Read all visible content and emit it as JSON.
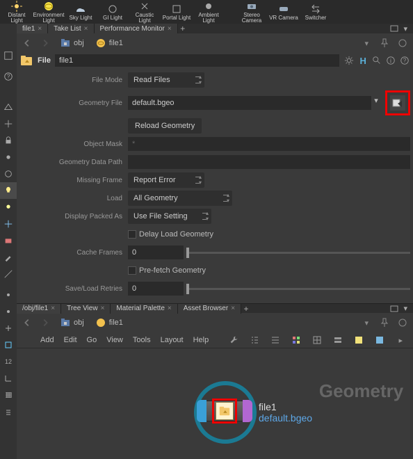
{
  "shelf": [
    {
      "label": "Distant Light"
    },
    {
      "label": "Environment Light"
    },
    {
      "label": "Sky Light"
    },
    {
      "label": "GI Light"
    },
    {
      "label": "Caustic Light"
    },
    {
      "label": "Portal Light"
    },
    {
      "label": "Ambient Light"
    },
    {
      "label": "Stereo Camera"
    },
    {
      "label": "VR Camera"
    },
    {
      "label": "Switcher"
    }
  ],
  "upper": {
    "tabs": [
      {
        "label": "file1"
      },
      {
        "label": "Take List"
      },
      {
        "label": "Performance Monitor"
      }
    ],
    "path": {
      "ctx": "obj",
      "node": "file1"
    },
    "header": {
      "kind": "File",
      "name": "file1"
    },
    "params": {
      "file_mode_label": "File Mode",
      "file_mode_value": "Read Files",
      "geometry_file_label": "Geometry File",
      "geometry_file_value": "default.bgeo",
      "reload_btn": "Reload Geometry",
      "object_mask_label": "Object Mask",
      "object_mask_value": "*",
      "geometry_data_path_label": "Geometry Data Path",
      "geometry_data_path_value": "",
      "missing_frame_label": "Missing Frame",
      "missing_frame_value": "Report Error",
      "load_label": "Load",
      "load_value": "All Geometry",
      "display_packed_label": "Display Packed As",
      "display_packed_value": "Use File Setting",
      "delay_load_label": "Delay Load Geometry",
      "cache_frames_label": "Cache Frames",
      "cache_frames_value": "0",
      "prefetch_label": "Pre-fetch Geometry",
      "save_retries_label": "Save/Load Retries",
      "save_retries_value": "0"
    }
  },
  "lower": {
    "tabs": [
      {
        "label": "/obj/file1"
      },
      {
        "label": "Tree View"
      },
      {
        "label": "Material Palette"
      },
      {
        "label": "Asset Browser"
      }
    ],
    "path": {
      "ctx": "obj",
      "node": "file1"
    },
    "menu": [
      "Add",
      "Edit",
      "Go",
      "View",
      "Tools",
      "Layout",
      "Help"
    ],
    "watermark": "Geometry",
    "node": {
      "name": "file1",
      "file": "default.bgeo"
    }
  }
}
